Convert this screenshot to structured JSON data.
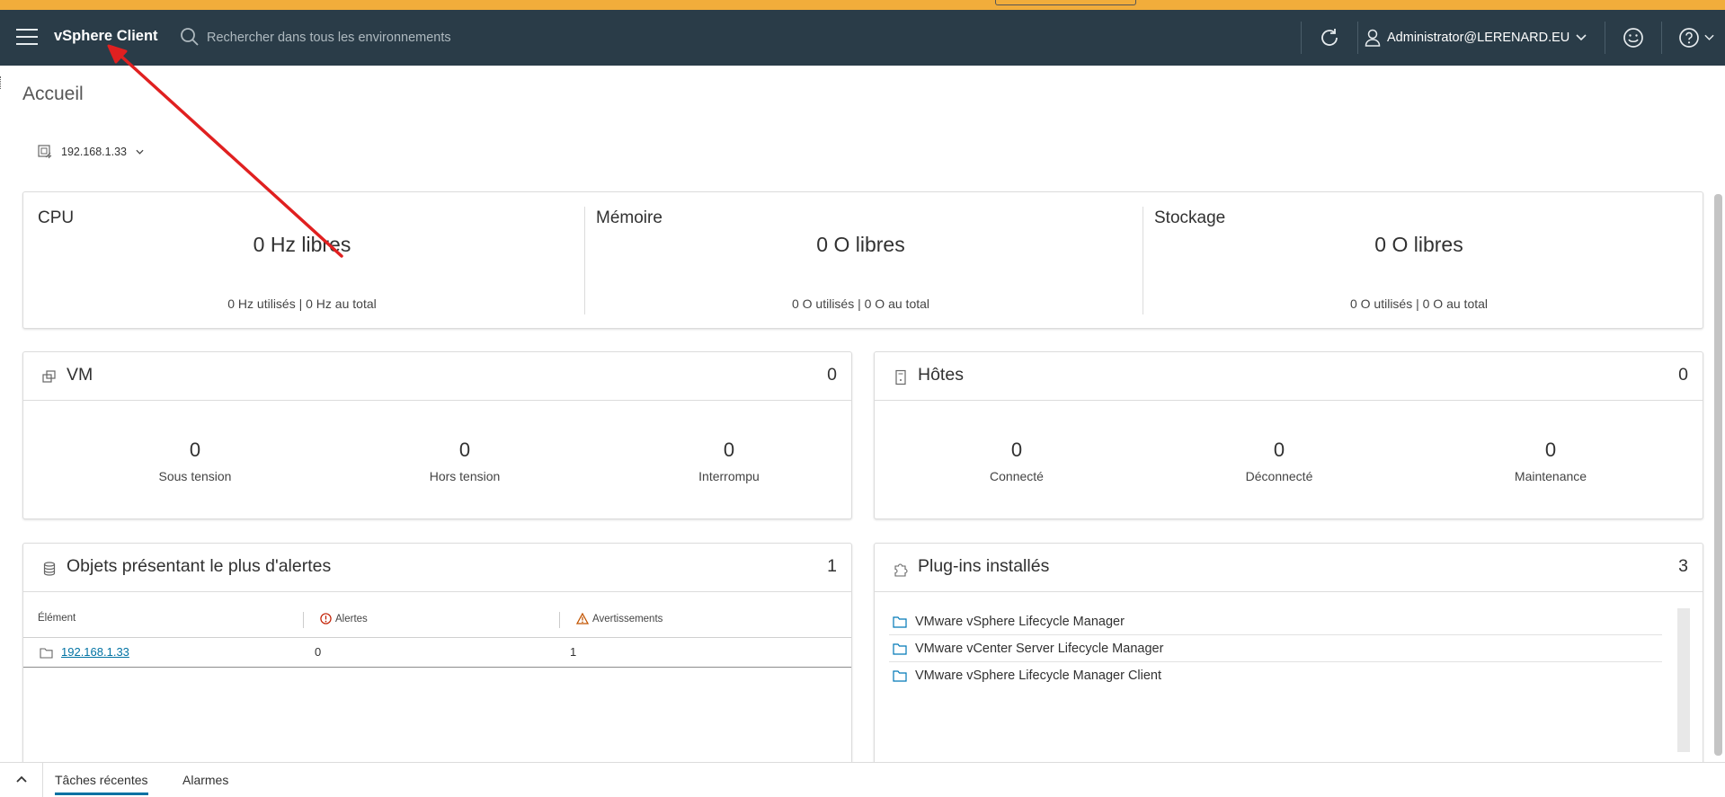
{
  "header": {
    "brand": "vSphere Client",
    "search_placeholder": "Rechercher dans tous les environnements",
    "user": "Administrator@LERENARD.EU"
  },
  "page": {
    "title": "Accueil",
    "host_selector": "192.168.1.33"
  },
  "resources": [
    {
      "label": "CPU",
      "free": "0 Hz libres",
      "detail": "0 Hz utilisés | 0 Hz au total"
    },
    {
      "label": "Mémoire",
      "free": "0 O libres",
      "detail": "0 O utilisés | 0 O au total"
    },
    {
      "label": "Stockage",
      "free": "0 O libres",
      "detail": "0 O utilisés | 0 O au total"
    }
  ],
  "vm": {
    "title": "VM",
    "count": "0",
    "stats": [
      {
        "value": "0",
        "label": "Sous tension"
      },
      {
        "value": "0",
        "label": "Hors tension"
      },
      {
        "value": "0",
        "label": "Interrompu"
      }
    ]
  },
  "hosts": {
    "title": "Hôtes",
    "count": "0",
    "stats": [
      {
        "value": "0",
        "label": "Connecté"
      },
      {
        "value": "0",
        "label": "Déconnecté"
      },
      {
        "value": "0",
        "label": "Maintenance"
      }
    ]
  },
  "alerts": {
    "title": "Objets présentant le plus d'alertes",
    "count": "1",
    "columns": [
      "Élément",
      "Alertes",
      "Avertissements"
    ],
    "rows": [
      {
        "element": "192.168.1.33",
        "alerts": "0",
        "warnings": "1"
      }
    ]
  },
  "plugins": {
    "title": "Plug-ins installés",
    "count": "3",
    "items": [
      "VMware vSphere Lifecycle Manager",
      "VMware vCenter Server Lifecycle Manager",
      "VMware vSphere Lifecycle Manager Client"
    ]
  },
  "footer": {
    "tabs": [
      "Tâches récentes",
      "Alarmes"
    ]
  },
  "colors": {
    "header_bg": "#2a3c48",
    "top_stripe": "#f1ad3b",
    "link": "#0072a3",
    "annotation_arrow": "#e02020"
  }
}
